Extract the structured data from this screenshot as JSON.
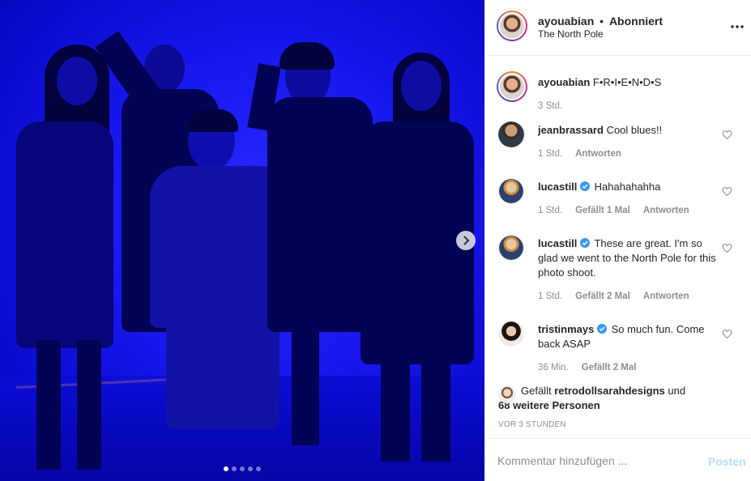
{
  "post": {
    "author": "ayouabian",
    "separator": "•",
    "follow_state": "Abonniert",
    "location": "The North Pole",
    "caption_author": "ayouabian",
    "caption_text": "F•R•I•E•N•D•S",
    "caption_age": "3 Std."
  },
  "carousel": {
    "slides": 5,
    "active_index": 0
  },
  "comments": [
    {
      "username": "jeanbrassard",
      "verified": false,
      "text": "Cool blues!!",
      "age": "1 Std.",
      "likes": "",
      "reply_label": "Antworten"
    },
    {
      "username": "lucastill",
      "verified": true,
      "text": "Hahahahahha",
      "age": "1 Std.",
      "likes": "Gefällt 1 Mal",
      "reply_label": "Antworten"
    },
    {
      "username": "lucastill",
      "verified": true,
      "text": "These are great. I'm so glad we went to the North Pole for this photo shoot.",
      "age": "1 Std.",
      "likes": "Gefällt 2 Mal",
      "reply_label": "Antworten"
    },
    {
      "username": "tristinmays",
      "verified": true,
      "text": "So much fun. Come back ASAP",
      "age": "36 Min.",
      "likes": "Gefällt 2 Mal",
      "reply_label": ""
    }
  ],
  "likes": {
    "prefix": "Gefällt",
    "liker": "retrodollsarahdesigns",
    "connector": "und",
    "others": "68 weitere Personen"
  },
  "timestamp": "VOR 3 STUNDEN",
  "comment_box": {
    "placeholder": "Kommentar hinzufügen ...",
    "post_label": "Posten"
  },
  "colors": {
    "photo_tint": "#1717ee",
    "verified_badge": "#3897f0",
    "post_button_disabled": "#b2dffc",
    "muted_text": "#8e8e8e"
  },
  "icons": {
    "more": "more-options-icon",
    "next": "chevron-right-icon",
    "like": "heart-outline-icon",
    "verified": "verified-badge-icon"
  }
}
